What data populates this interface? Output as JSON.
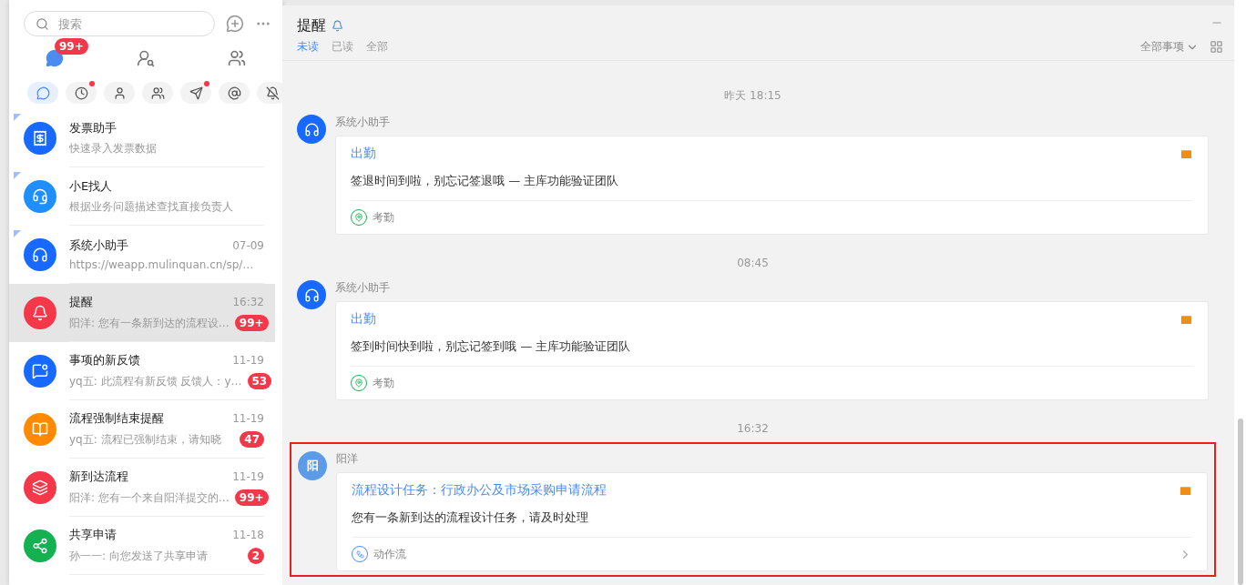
{
  "sidebar": {
    "search": {
      "placeholder": "搜索"
    },
    "top_tabs": [
      {
        "kind": "chat",
        "badge": "99+",
        "selected": true
      },
      {
        "kind": "contacts",
        "selected": false
      },
      {
        "kind": "groups",
        "selected": false
      }
    ],
    "filters": [
      {
        "kind": "chat",
        "selected": true,
        "dot": false
      },
      {
        "kind": "clock",
        "selected": false,
        "dot": true
      },
      {
        "kind": "user",
        "selected": false,
        "dot": false
      },
      {
        "kind": "users",
        "selected": false,
        "dot": false
      },
      {
        "kind": "send",
        "selected": false,
        "dot": true
      },
      {
        "kind": "at",
        "selected": false,
        "dot": false
      },
      {
        "kind": "mute",
        "selected": false,
        "dot": false
      }
    ],
    "conversations": [
      {
        "kind": "receipt",
        "color": "#1769ff",
        "name": "发票助手",
        "preview": "快速录入发票数据",
        "pinned": true,
        "selected": false
      },
      {
        "kind": "assistant",
        "color": "#1f8fff",
        "name": "小E找人",
        "preview": "根据业务问题描述查找直接负责人",
        "pinned": true,
        "selected": false
      },
      {
        "kind": "headset",
        "color": "#1769ff",
        "name": "系统小助手",
        "preview": "https://weapp.mulinquan.cn/sp/…",
        "time": "07-09",
        "pinned": true,
        "selected": false
      },
      {
        "kind": "bell",
        "color": "#f5374a",
        "name": "提醒",
        "preview": "阳洋: 您有一条新到达的流程设…",
        "time": "16:32",
        "badge": "99+",
        "pinned": false,
        "selected": true
      },
      {
        "kind": "feedback",
        "color": "#1769ff",
        "name": "事项的新反馈",
        "preview": "yq五: 此流程有新反馈 反馈人：y…",
        "time": "11-19",
        "badge": "53",
        "pinned": false,
        "selected": false
      },
      {
        "kind": "stop",
        "color": "#ff8a00",
        "name": "流程强制结束提醒",
        "preview": "yq五: 流程已强制结束，请知晓",
        "time": "11-19",
        "badge": "47",
        "pinned": false,
        "selected": false
      },
      {
        "kind": "layers",
        "color": "#f5374a",
        "name": "新到达流程",
        "preview": "阳洋: 您有一个来自阳洋提交的…",
        "time": "11-19",
        "badge": "99+",
        "pinned": false,
        "selected": false
      },
      {
        "kind": "share",
        "color": "#13b14f",
        "name": "共享申请",
        "preview": "孙一一: 向您发送了共享申请",
        "time": "11-18",
        "badge": "2",
        "pinned": false,
        "selected": false
      }
    ]
  },
  "header": {
    "title": "提醒",
    "tabs": [
      {
        "label": "未读",
        "selected": true
      },
      {
        "label": "已读",
        "selected": false
      },
      {
        "label": "全部",
        "selected": false
      }
    ],
    "filter": "全部事项"
  },
  "feed": [
    {
      "kind": "time",
      "text": "昨天 18:15"
    },
    {
      "kind": "message",
      "sender": "系统小助手",
      "title": "出勤",
      "body": "签退时间到啦，别忘记签退哦 — 主库功能验证团队",
      "footer": {
        "kind": "location",
        "text": "考勤"
      },
      "highlighted": false,
      "link": false
    },
    {
      "kind": "time",
      "text": "08:45"
    },
    {
      "kind": "message",
      "sender": "系统小助手",
      "title": "出勤",
      "body": "签到时间快到啦，别忘记签到哦 — 主库功能验证团队",
      "footer": {
        "kind": "location",
        "text": "考勤"
      },
      "highlighted": false,
      "link": false
    },
    {
      "kind": "time",
      "text": "16:32"
    },
    {
      "kind": "message",
      "avatar_text": "阳",
      "sender": "阳洋",
      "title": "流程设计任务：行政办公及市场采购申请流程",
      "body": "您有一条新到达的流程设计任务，请及时处理",
      "footer": {
        "kind": "flow",
        "text": "动作流"
      },
      "highlighted": true,
      "link": true
    }
  ]
}
